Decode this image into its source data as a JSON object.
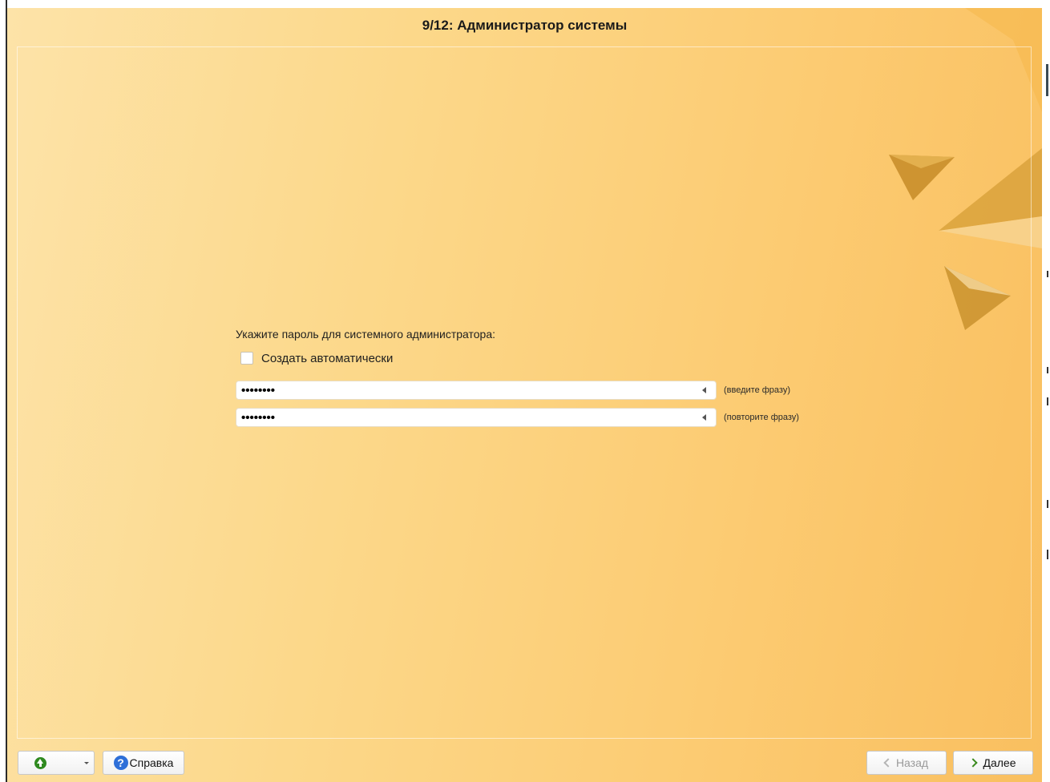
{
  "window": {
    "title": "9/12: Администратор системы"
  },
  "form": {
    "prompt": "Укажите пароль для системного администратора:",
    "auto_generate": {
      "label": "Создать автоматически",
      "checked": false
    },
    "password": {
      "value": "••••••••",
      "hint": "(введите фразу)"
    },
    "password_repeat": {
      "value": "••••••••",
      "hint": "(повторите фразу)"
    }
  },
  "bottom_bar": {
    "up_icon": "up-arrow-icon",
    "help_label": "Справка",
    "help_icon": "question-icon",
    "back_label": "Назад",
    "next_label": "Далее"
  },
  "colors": {
    "background_start": "#fde3a8",
    "background_end": "#f9bf5f",
    "up_icon": "#2f8a1f",
    "help_icon": "#2e6fd8"
  }
}
